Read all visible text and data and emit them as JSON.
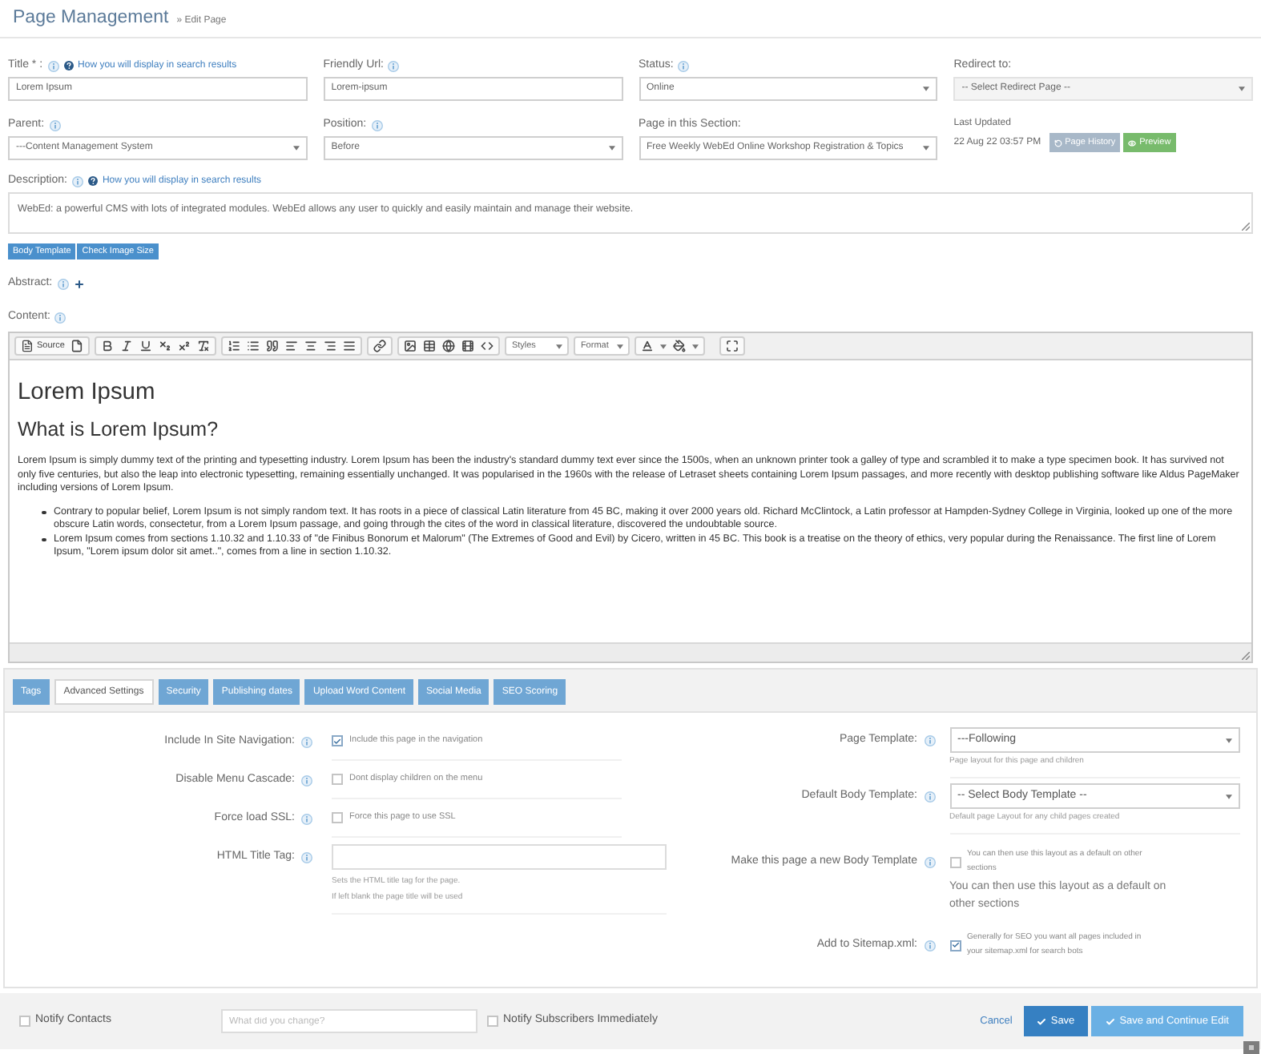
{
  "header": {
    "title": "Page Management",
    "breadcrumb": "» Edit Page"
  },
  "fields": [
    {
      "label": "Title * :",
      "kind": "text",
      "value": "Lorem Ipsum",
      "info": true,
      "help_link": "How you will display in search results",
      "disabled": false
    },
    {
      "label": "Friendly Url:",
      "kind": "text",
      "value": "Lorem-ipsum",
      "info": true,
      "disabled": false
    },
    {
      "label": "Status:",
      "kind": "select",
      "value": "Online",
      "info": true,
      "disabled": false
    },
    {
      "label": "Redirect to:",
      "kind": "select",
      "value": "-- Select Redirect Page --",
      "info": false,
      "disabled": true
    },
    {
      "label": "Parent:",
      "kind": "select",
      "value": "---Content Management System",
      "info": true,
      "disabled": false
    },
    {
      "label": "Position:",
      "kind": "select",
      "value": "Before",
      "info": true,
      "disabled": false
    },
    {
      "label": "Page in this Section:",
      "kind": "select",
      "value": "Free Weekly WebEd Online Workshop Registration & Topics",
      "info": false,
      "disabled": false
    }
  ],
  "last_updated": {
    "label": "Last Updated",
    "value": "22 Aug 22 03:57 PM",
    "buttons": [
      {
        "label": "Page History",
        "kind": "history"
      },
      {
        "label": "Preview",
        "kind": "preview"
      }
    ]
  },
  "description": {
    "label": "Description:",
    "info": true,
    "help_link": "How you will display in search results",
    "value": "WebEd: a powerful CMS with lots of integrated modules. WebEd allows any user to quickly and easily maintain and manage their website."
  },
  "template_buttons": [
    "Body Template",
    "Check Image Size"
  ],
  "abstract": {
    "label": "Abstract:"
  },
  "content": {
    "label": "Content:"
  },
  "editor": {
    "toolbar": {
      "source": "Source",
      "dropdowns": [
        "Styles",
        "Format"
      ]
    },
    "heading_1": "Lorem Ipsum",
    "heading_2": "What is Lorem Ipsum?",
    "paragraph": "Lorem Ipsum is simply dummy text of the printing and typesetting industry. Lorem Ipsum has been the industry's standard dummy text ever since the 1500s, when an unknown printer took a galley of type and scrambled it to make a type specimen book. It has survived not only five centuries, but also the leap into electronic typesetting, remaining essentially unchanged. It was popularised in the 1960s with the release of Letraset sheets containing Lorem Ipsum passages, and more recently with desktop publishing software like Aldus PageMaker including versions of Lorem Ipsum.",
    "bullets": [
      "Contrary to popular belief, Lorem Ipsum is not simply random text. It has roots in a piece of classical Latin literature from 45 BC, making it over 2000 years old. Richard McClintock, a Latin professor at Hampden-Sydney College in Virginia, looked up one of the more obscure Latin words, consectetur, from a Lorem Ipsum passage, and going through the cites of the word in classical literature, discovered the undoubtable source.",
      "Lorem Ipsum comes from sections 1.10.32 and 1.10.33 of \"de Finibus Bonorum et Malorum\" (The Extremes of Good and Evil) by Cicero, written in 45 BC. This book is a treatise on the theory of ethics, very popular during the Renaissance. The first line of Lorem Ipsum, \"Lorem ipsum dolor sit amet..\", comes from a line in section 1.10.32."
    ]
  },
  "tabs": [
    {
      "label": "Tags",
      "selected": false
    },
    {
      "label": "Advanced Settings",
      "selected": true
    },
    {
      "label": "Security",
      "selected": false
    },
    {
      "label": "Publishing dates",
      "selected": false
    },
    {
      "label": "Upload Word Content",
      "selected": false
    },
    {
      "label": "Social Media",
      "selected": false
    },
    {
      "label": "SEO Scoring",
      "selected": false
    }
  ],
  "settings_left": [
    {
      "kind": "checkbox",
      "label": "Include In Site Navigation:",
      "checked": true,
      "text": "Include this page in the navigation"
    },
    {
      "kind": "checkbox",
      "label": "Disable Menu Cascade:",
      "checked": false,
      "text": "Dont display children on the menu"
    },
    {
      "kind": "checkbox",
      "label": "Force load SSL:",
      "checked": false,
      "text": "Force this page to use SSL"
    },
    {
      "kind": "input",
      "label": "HTML Title Tag:",
      "help": [
        "Sets the HTML title tag for the page.",
        "If left blank the page title will be used"
      ]
    }
  ],
  "settings_right": [
    {
      "kind": "select",
      "label": "Page Template:",
      "value": "---Following",
      "help": "Page layout for this page and children"
    },
    {
      "kind": "select",
      "label": "Default Body Template:",
      "value": "-- Select Body Template --",
      "help": "Default page Layout for any child pages created"
    },
    {
      "kind": "checkbox",
      "label": "Make this page a new Body Template",
      "checked": false,
      "text": "You can then use this layout as a default on other sections",
      "note": "You can then use this layout as a default on other sections"
    },
    {
      "kind": "checkbox",
      "label": "Add to Sitemap.xml:",
      "checked": true,
      "text": "Generally for SEO you want all pages included in your sitemap.xml for search bots"
    }
  ],
  "footer": {
    "notify_contacts": {
      "label": "Notify Contacts",
      "checked": false
    },
    "change_note": {
      "placeholder": "What did you change?"
    },
    "notify_subscribers": {
      "label": "Notify Subscribers Immediately",
      "checked": false
    },
    "cancel": "Cancel",
    "buttons": [
      {
        "label": "Save",
        "kind": "primary"
      },
      {
        "label": "Save and Continue Edit",
        "kind": "secondary"
      }
    ]
  }
}
